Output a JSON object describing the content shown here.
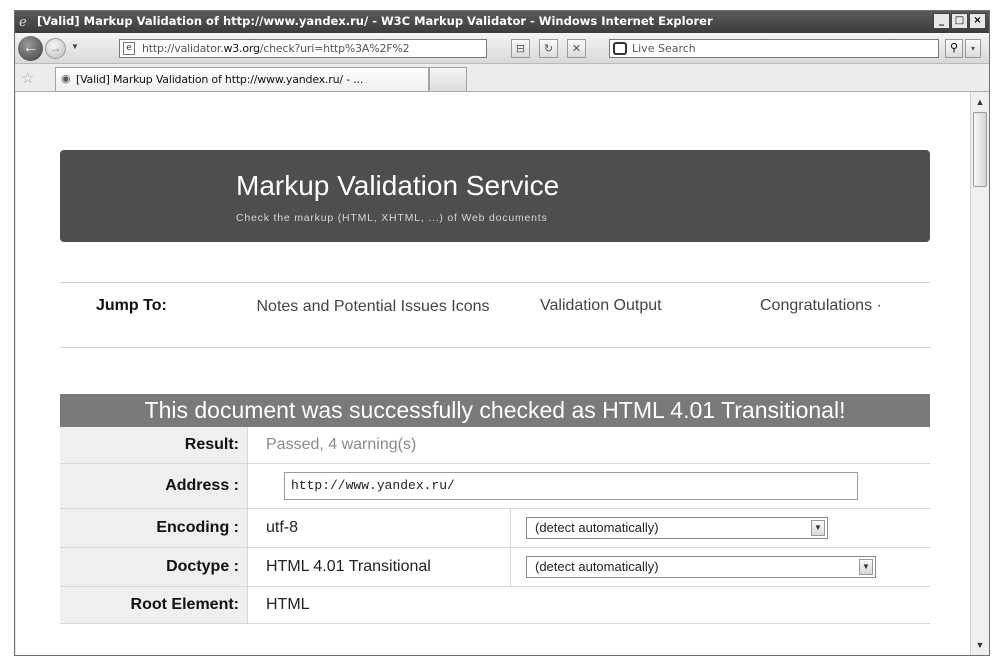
{
  "window": {
    "title": "[Valid] Markup Validation of http://www.yandex.ru/ - W3C Markup Validator - Windows Internet Explorer",
    "controls": [
      "_",
      "□",
      "×"
    ]
  },
  "navbar": {
    "address_prefix": "http://validator.",
    "address_domain": "w3.org",
    "address_rest": "/check?uri=http%3A%2F%2",
    "search_placeholder": "Live Search"
  },
  "tab": {
    "label": "[Valid] Markup Validation of http://www.yandex.ru/ - ..."
  },
  "banner": {
    "title": "Markup Validation Service",
    "subtitle": "Check the markup (HTML, XHTML, ...) of Web documents"
  },
  "jump": {
    "label": "Jump To:",
    "links": [
      "Notes and Potential Issues Icons",
      "Validation Output",
      "Congratulations ·"
    ]
  },
  "result": {
    "heading": "This document was successfully checked as HTML 4.01 Transitional!",
    "rows": {
      "result_label": "Result:",
      "result_value": "Passed, 4 warning(s)",
      "address_label": "Address :",
      "address_value": "http://www.yandex.ru/",
      "encoding_label": "Encoding :",
      "encoding_value": "utf-8",
      "encoding_select": "(detect automatically)",
      "doctype_label": "Doctype :",
      "doctype_value": "HTML 4.01 Transitional",
      "doctype_select": "(detect automatically)",
      "root_label": "Root Element:",
      "root_value": "HTML"
    }
  }
}
